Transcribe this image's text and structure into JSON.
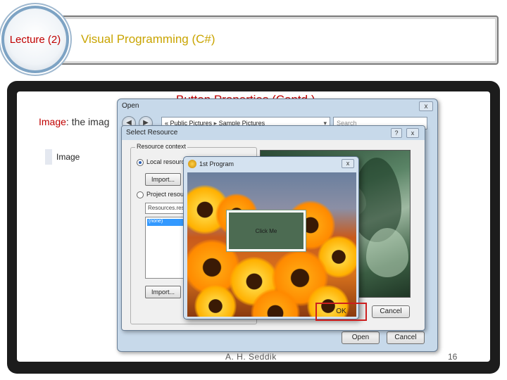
{
  "header": {
    "lecture": "Lecture (2)",
    "course": "Visual Programming (C#)"
  },
  "slide": {
    "title": "Button Properties (Contd.)",
    "body_keyword": "Image",
    "body_rest": ": the imag",
    "property_label": "Image"
  },
  "open_dialog": {
    "title": "Open",
    "close": "x",
    "back": "◀",
    "forward": "▶",
    "address": {
      "prefix": "«",
      "path1": "Public Pictures",
      "arrow": "▸",
      "path2": "Sample Pictures",
      "dropdown": "▾"
    },
    "search_placeholder": "Search",
    "open_button": "Open",
    "cancel_button": "Cancel"
  },
  "select_resource": {
    "title": "Select Resource",
    "help": "?",
    "close": "x",
    "group_label": "Resource context",
    "local_resource": "Local resource:",
    "import_button": "Import...",
    "project_resource": "Project resource file:",
    "resource_file": "Resources.resx",
    "list_selected": "(none)",
    "import_button_2": "Import...",
    "ok_button": "OK",
    "cancel_button": "Cancel"
  },
  "program_window": {
    "title": "1st Program",
    "close": "x",
    "button_label": "Click Me"
  },
  "footer": {
    "author": "A. H. Seddik",
    "page": "16"
  },
  "colors": {
    "lecture_text": "#c00000",
    "course_text": "#c9a400",
    "title_text": "#c00000",
    "highlight_box": "#cc1f1f",
    "slide_frame": "#1c1c1c"
  }
}
